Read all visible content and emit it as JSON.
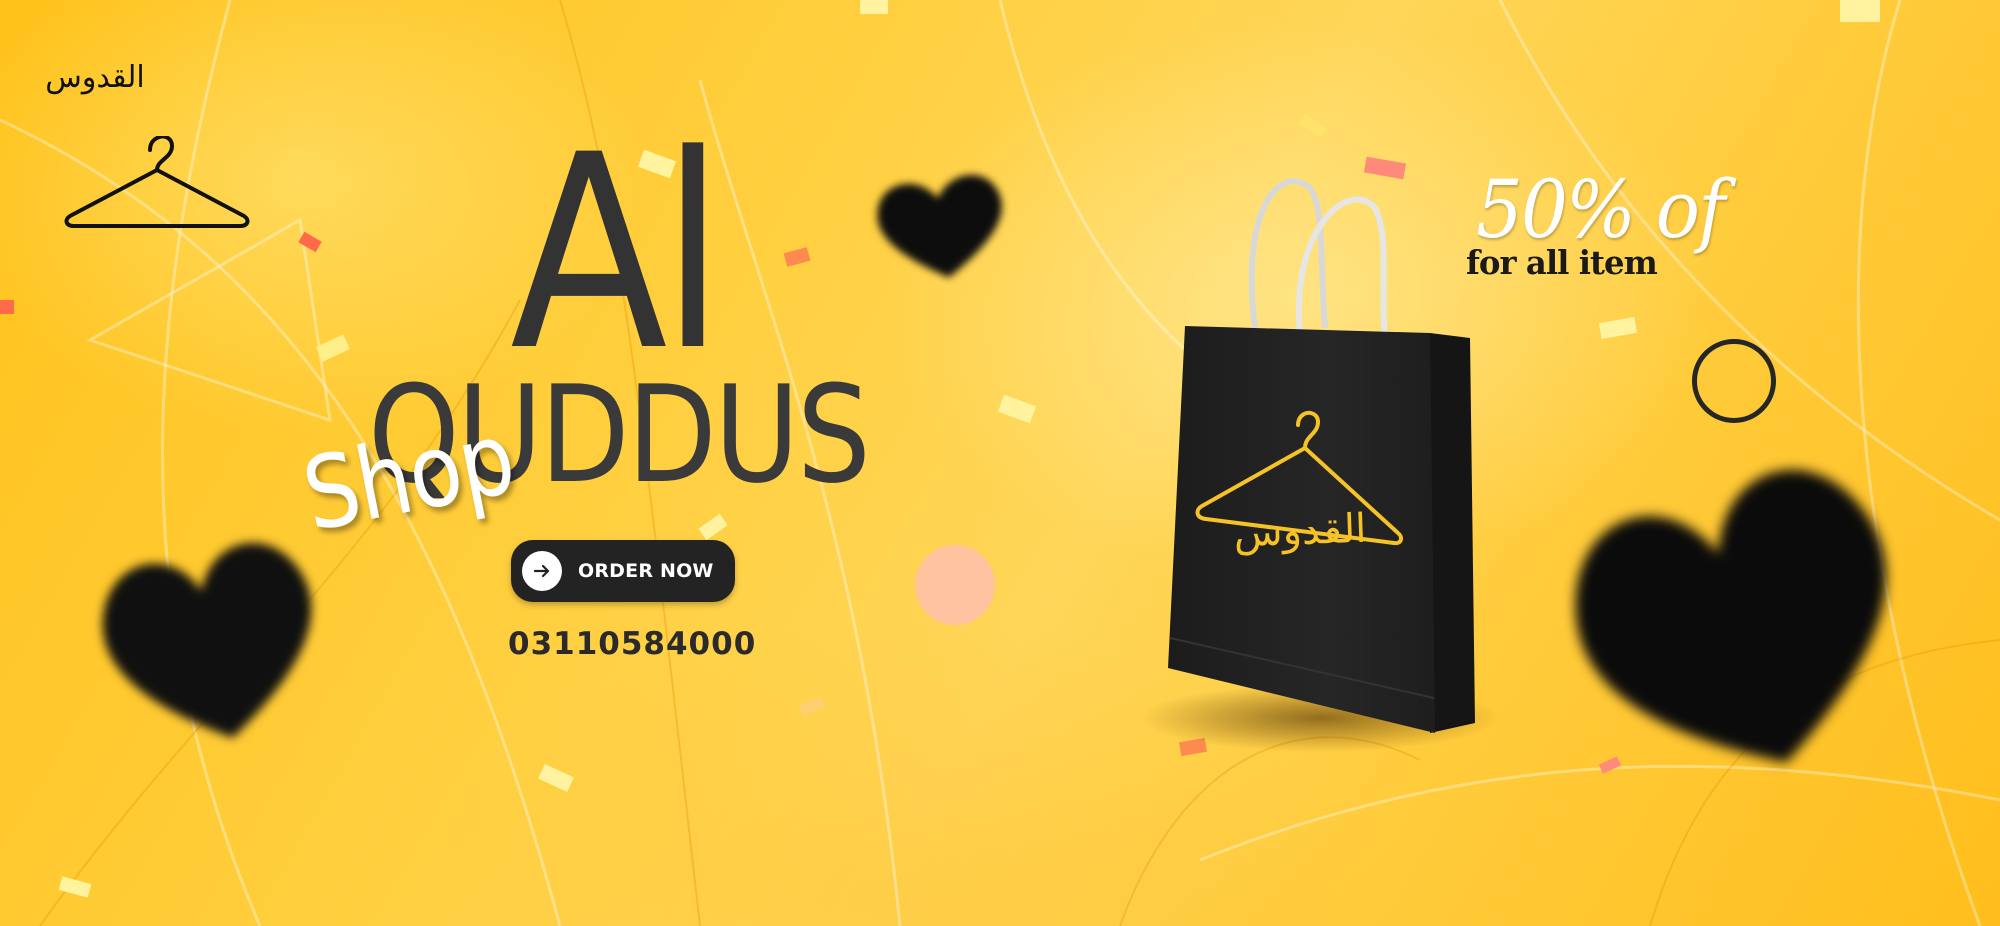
{
  "brand": {
    "logo_text": "القدوس",
    "logo_icon": "hanger-icon",
    "title_line1": "Al",
    "title_line2": "QUDDUS",
    "title_overlay": "Shop"
  },
  "cta": {
    "label": "ORDER NOW",
    "icon": "arrow-right-icon"
  },
  "contact": {
    "phone": "03110584000"
  },
  "bag": {
    "print_text": "القدوس",
    "icon": "hanger-icon"
  },
  "promo": {
    "headline": "50% of",
    "subline": "for all item"
  },
  "colors": {
    "background": "#ffc93a",
    "dark": "#232323",
    "accent_yellow": "#f5c227",
    "white": "#ffffff"
  }
}
